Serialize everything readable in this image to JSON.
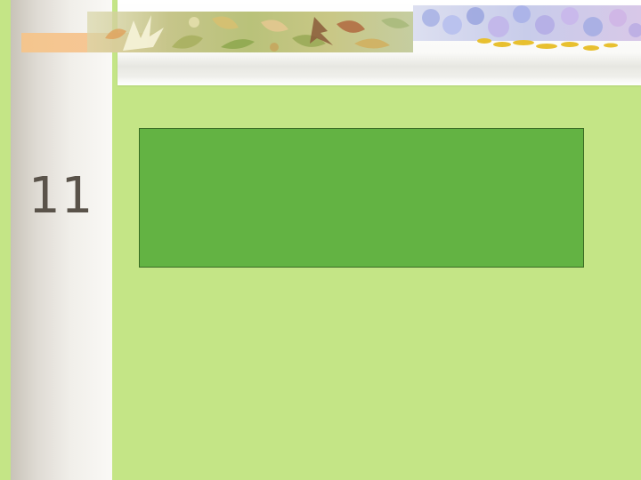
{
  "slide": {
    "number": "11",
    "background_color": "#c4e586",
    "content_box_color": "#63b343",
    "number_color": "#5a534a"
  },
  "decorations": {
    "left_banner_icon": "autumn-leaves-icon",
    "right_banner_icon": "hydrangea-flowers-icon"
  }
}
